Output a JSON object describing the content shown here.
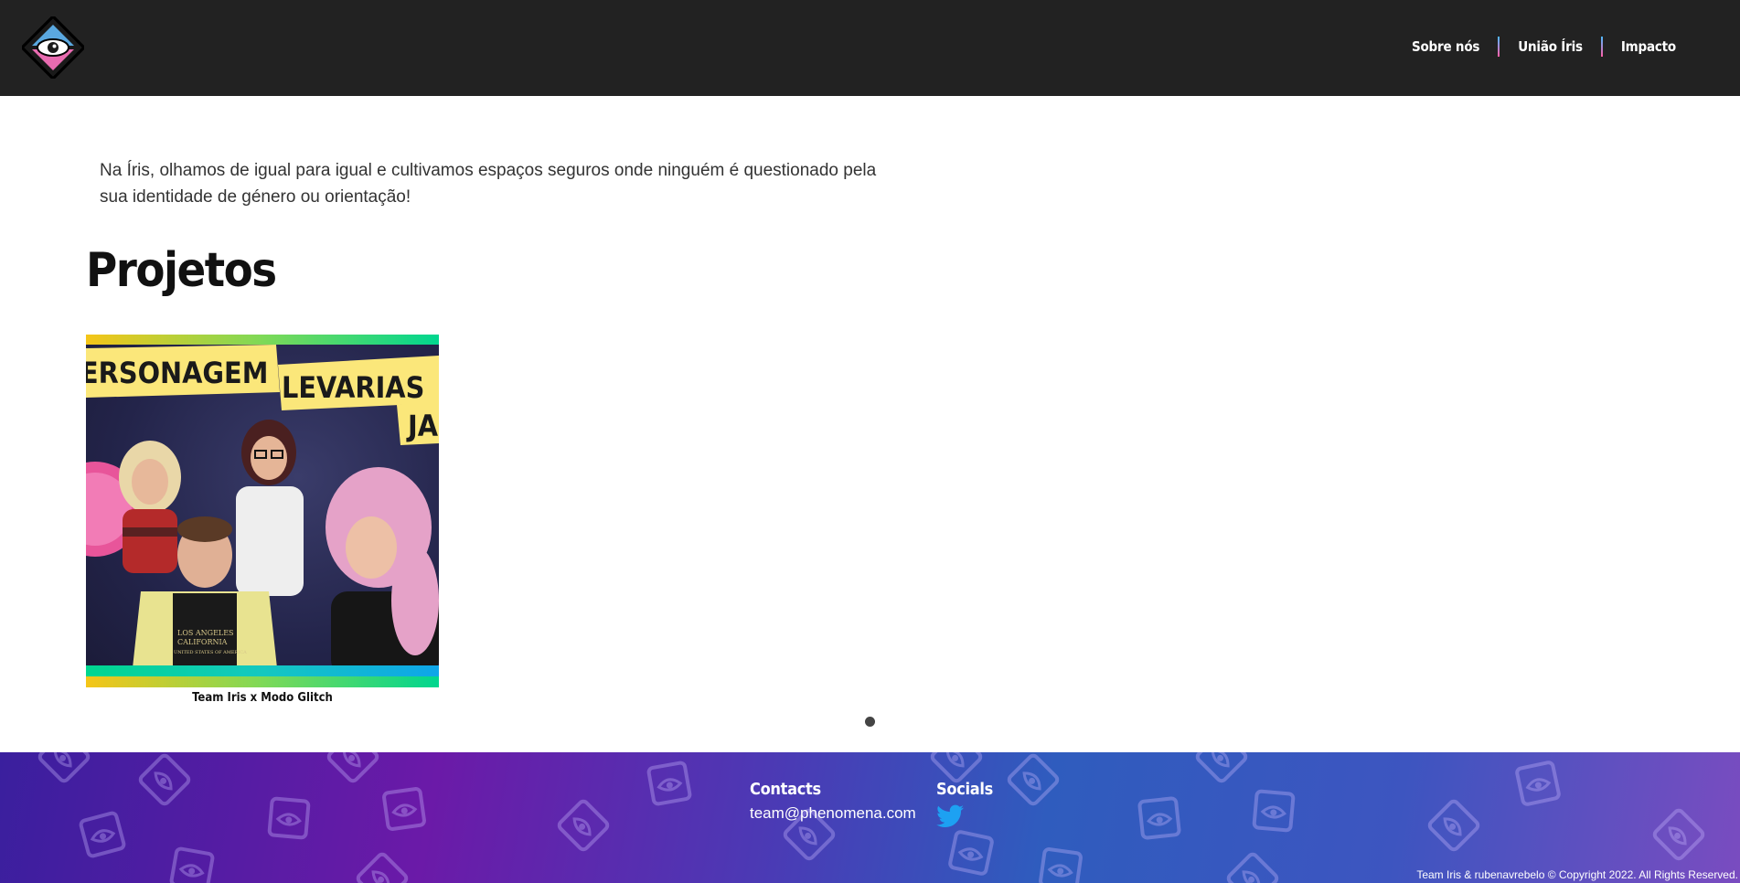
{
  "header": {
    "nav": [
      {
        "label": "Sobre nós"
      },
      {
        "label": "União Íris"
      },
      {
        "label": "Impacto"
      }
    ]
  },
  "intro": {
    "text": "Na Íris, olhamos de igual para igual e cultivamos espaços seguros onde ninguém é questionado pela sua identidade de género ou orientação!"
  },
  "projects": {
    "title": "Projetos",
    "items": [
      {
        "caption": "Team Iris x Modo Glitch",
        "image_text": [
          "ERSONAGEM",
          "LEVARIAS",
          "JA",
          "LOS ANGELES",
          "CALIFORNIA",
          "UNITED STATES OF AMERICA"
        ]
      }
    ]
  },
  "footer": {
    "contacts_title": "Contacts",
    "email": "team@phenomena.com",
    "socials_title": "Socials",
    "social_icon": "twitter-icon",
    "copyright": "Team Iris & rubenavrebelo © Copyright 2022. All Rights Reserved."
  },
  "colors": {
    "header_bg": "#222222",
    "twitter_blue": "#1da1f2",
    "nav_separator": "#ff5fa8"
  }
}
